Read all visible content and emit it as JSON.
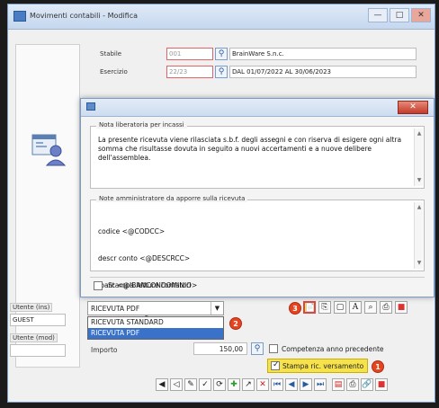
{
  "main_window": {
    "title": "Movimenti contabili - Modifica",
    "controls": {
      "minimize": "—",
      "maximize": "□",
      "close": "✕"
    }
  },
  "form": {
    "stabile": {
      "label": "Stabile",
      "code": "001",
      "description": "BrainWare S.n.c."
    },
    "esercizio": {
      "label": "Esercizio",
      "code": "22/23",
      "description": "DAL 01/07/2022 AL 30/06/2023"
    }
  },
  "left_panel": {
    "utente_ins_label": "Utente (ins)",
    "utente_ins_value": "GUEST",
    "utente_mod_label": "Utente (mod)",
    "utente_mod_value": ""
  },
  "dialog": {
    "close_label": "✕",
    "nota_liberatoria": {
      "title": "Nota liberatoria per incassi",
      "text": "La presente ricevuta viene rilasciata s.b.f. degli assegni e con riserva di esigere ogni altra somma che risultasse dovuta in seguito a nuovi accertamenti e a nuove delibere dell'assemblea."
    },
    "note_amministratore": {
      "title": "Note amministratore da apporre sulla ricevuta",
      "lines": [
        "codice <@CODCC>",
        "descr conto <@DESCRCC>",
        "Iban: <@IBANCONDOMINIO>",
        "descr mov: <@DESCRMOVIMENTO>"
      ]
    },
    "stampa_letture": {
      "label": "Stampa letture contatori",
      "checked": false
    }
  },
  "print_select": {
    "selected": "RICEVUTA PDF",
    "options": [
      "RICEVUTA STANDARD",
      "RICEVUTA PDF"
    ],
    "highlighted_option": "RICEVUTA PDF"
  },
  "badges": {
    "b1": "1",
    "b2": "2",
    "b3": "3"
  },
  "importo": {
    "label": "Importo",
    "value": "150,00"
  },
  "competenza": {
    "label": "Competenza anno precedente",
    "checked": false
  },
  "stampa_ricevuta": {
    "label": "Stampa ric. versamento",
    "checked": true
  },
  "colors": {
    "highlight": "#f6e24a",
    "badge": "#e4451f",
    "selection": "#3a72c9"
  }
}
